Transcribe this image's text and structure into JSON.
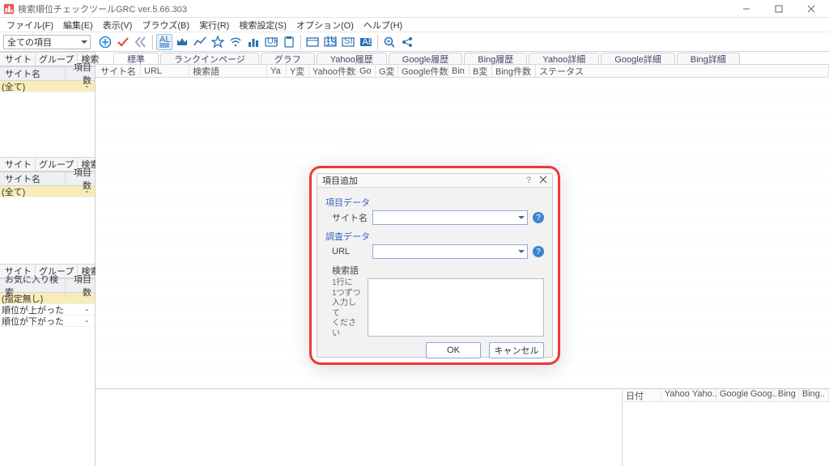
{
  "window": {
    "title": "検索順位チェックツールGRC  ver.5.66.303"
  },
  "menu": [
    "ファイル(F)",
    "編集(E)",
    "表示(V)",
    "ブラウズ(B)",
    "実行(R)",
    "検索設定(S)",
    "オプション(O)",
    "ヘルプ(H)"
  ],
  "filter_combo": "全ての項目",
  "left_panels": {
    "sites": {
      "cols": [
        "サイト",
        "グループ",
        "検索"
      ],
      "head": [
        "サイト名",
        "項目数"
      ],
      "rows": [
        [
          "(全て)",
          "-"
        ]
      ]
    },
    "groups": {
      "cols": [
        "サイト",
        "グループ",
        "検索"
      ],
      "head": [
        "サイト名",
        "項目数"
      ],
      "rows": [
        [
          "(全て)",
          "-"
        ]
      ]
    },
    "fav": {
      "cols": [
        "サイト",
        "グループ",
        "検索"
      ],
      "head": [
        "お気に入り検索",
        "項目数"
      ],
      "rows": [
        [
          "(指定無し)",
          ""
        ],
        [
          "順位が上がった",
          "-"
        ],
        [
          "順位が下がった",
          "-"
        ]
      ]
    }
  },
  "tabs": [
    "標準",
    "ランクインページ",
    "グラフ",
    "Yahoo履歴",
    "Google履歴",
    "Bing履歴",
    "Yahoo詳細",
    "Google詳細",
    "Bing詳細"
  ],
  "columns": [
    "サイト名",
    "URL",
    "検索語",
    "Ya",
    "Y変",
    "Yahoo件数",
    "Go",
    "G変",
    "Google件数",
    "Bin",
    "B変",
    "Bing件数",
    "ステータス"
  ],
  "log_cols": [
    "日付",
    "Yahoo",
    "Yaho..",
    "Google",
    "Goog..",
    "Bing",
    "Bing.."
  ],
  "toolbar_icons": [
    "plus",
    "check",
    "chevrons",
    "all",
    "crown",
    "line",
    "star",
    "wifi",
    "chart",
    "url",
    "clip",
    "screen",
    "1url",
    "site",
    "ab",
    "zoom",
    "share"
  ],
  "dialog": {
    "title": "項目追加",
    "section1": "項目データ",
    "site_label": "サイト名",
    "section2": "調査データ",
    "url_label": "URL",
    "kw_label": "検索語",
    "kw_hint": "1行に\n1つずつ\n入力して\nください",
    "ok": "OK",
    "cancel": "キャンセル"
  }
}
